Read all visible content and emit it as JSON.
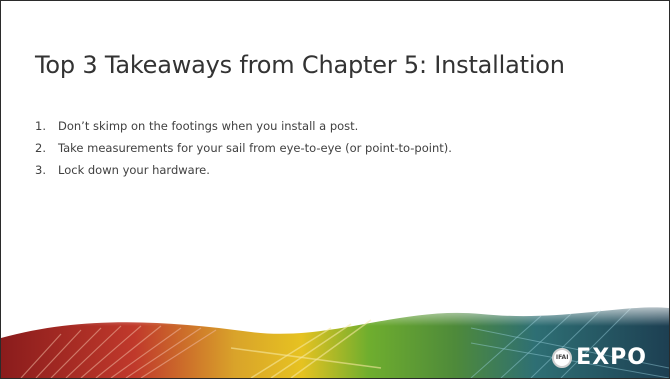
{
  "slide": {
    "title": "Top 3 Takeaways from Chapter 5: Installation",
    "items": [
      {
        "number": "1.",
        "text": "Don’t skimp on the footings when you install a post."
      },
      {
        "number": "2.",
        "text": "Take measurements for your sail from eye-to-eye (or point-to-point)."
      },
      {
        "number": "3.",
        "text": "Lock down your hardware."
      }
    ]
  },
  "logo": {
    "badge": "IFAI",
    "text": "EXPO"
  },
  "colors": {
    "title": "#333333",
    "body": "#404040",
    "banner_red": "#b8282a",
    "banner_yellow": "#e6c221",
    "banner_green": "#5a9a2a",
    "banner_teal": "#2e6f74"
  }
}
